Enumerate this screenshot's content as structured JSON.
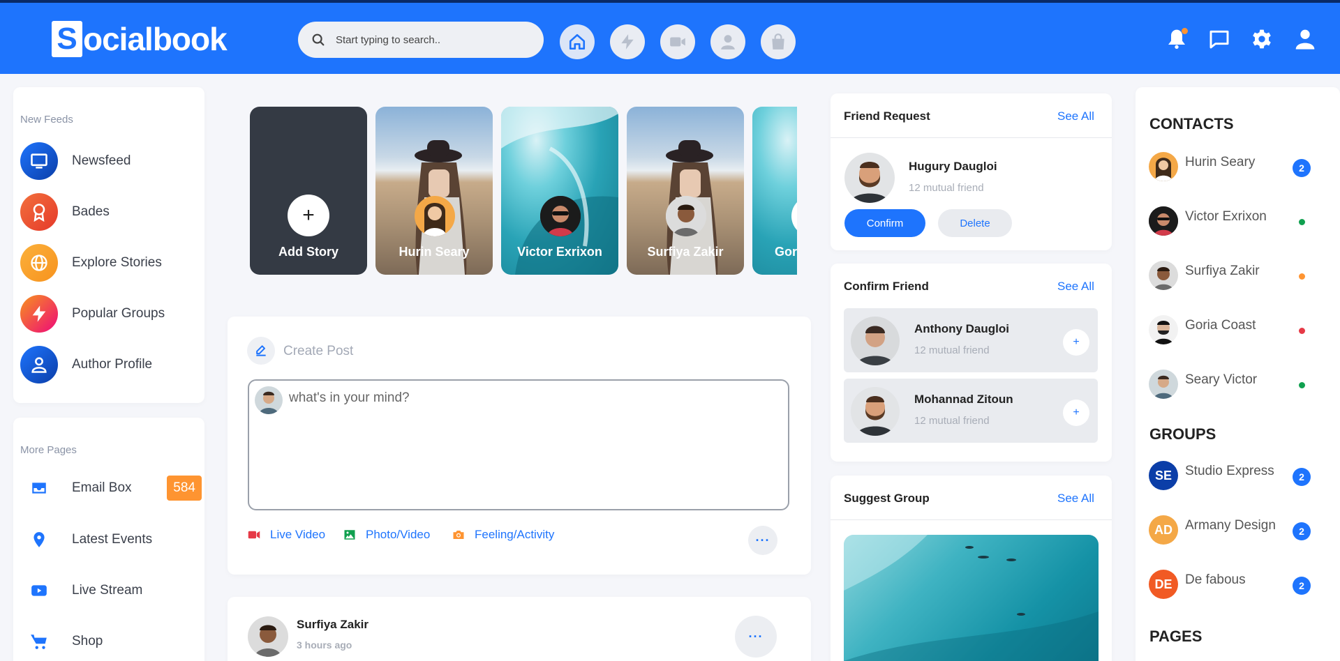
{
  "app": {
    "logo_letter": "S",
    "logo_rest": "ocialbook"
  },
  "search": {
    "placeholder": "Start typing to search.."
  },
  "colors": {
    "primary": "#1e74fd",
    "orange": "#fe9431",
    "dark": "#343a44"
  },
  "header_icons": [
    "home-icon",
    "lightning-icon",
    "video-icon",
    "user-icon",
    "shopping-bag-icon"
  ],
  "header_right_icons": [
    "bell-icon",
    "chat-icon",
    "settings-icon",
    "user-icon"
  ],
  "sidebar": {
    "feeds_title": "New Feeds",
    "feeds": [
      {
        "label": "Newsfeed",
        "icon": "tv-icon"
      },
      {
        "label": "Bades",
        "icon": "badge-icon"
      },
      {
        "label": "Explore Stories",
        "icon": "globe-icon"
      },
      {
        "label": "Popular Groups",
        "icon": "lightning-icon"
      },
      {
        "label": "Author Profile",
        "icon": "user-icon"
      }
    ],
    "pages_title": "More Pages",
    "pages": [
      {
        "label": "Email Box",
        "icon": "inbox-icon",
        "badge": "584"
      },
      {
        "label": "Latest Events",
        "icon": "map-pin-icon"
      },
      {
        "label": "Live Stream",
        "icon": "youtube-icon"
      },
      {
        "label": "Shop",
        "icon": "cart-icon"
      }
    ]
  },
  "stories": {
    "add_label": "Add Story",
    "items": [
      {
        "name": "Hurin Seary"
      },
      {
        "name": "Victor Exrixon"
      },
      {
        "name": "Surfiya Zakir"
      },
      {
        "name": "Gor"
      }
    ]
  },
  "create_post": {
    "title": "Create Post",
    "placeholder": "what's in your mind?",
    "actions": [
      {
        "label": "Live Video",
        "icon": "video-icon"
      },
      {
        "label": "Photo/Video",
        "icon": "image-icon"
      },
      {
        "label": "Feeling/Activity",
        "icon": "camera-icon"
      }
    ],
    "more": "···"
  },
  "post": {
    "author": "Surfiya Zakir",
    "time": "3 hours ago",
    "more": "···"
  },
  "friend_request": {
    "title": "Friend Request",
    "see_all": "See All",
    "name": "Hugury Daugloi",
    "mutual": "12 mutual friend",
    "confirm": "Confirm",
    "delete": "Delete"
  },
  "confirm_friend": {
    "title": "Confirm Friend",
    "see_all": "See All",
    "items": [
      {
        "name": "Anthony Daugloi",
        "mutual": "12 mutual friend",
        "action": "+"
      },
      {
        "name": "Mohannad Zitoun",
        "mutual": "12 mutual friend",
        "action": "+"
      }
    ]
  },
  "suggest_group": {
    "title": "Suggest Group",
    "see_all": "See All"
  },
  "contacts": {
    "title": "CONTACTS",
    "items": [
      {
        "name": "Hurin Seary",
        "badge": "2"
      },
      {
        "name": "Victor Exrixon",
        "status": "#10a04f"
      },
      {
        "name": "Surfiya Zakir",
        "status": "#fe9431"
      },
      {
        "name": "Goria Coast",
        "status": "#e63946"
      },
      {
        "name": "Seary Victor",
        "status": "#10a04f"
      }
    ]
  },
  "groups": {
    "title": "GROUPS",
    "items": [
      {
        "initials": "SE",
        "name": "Studio Express",
        "badge": "2",
        "color": "#0b3ea8"
      },
      {
        "initials": "AD",
        "name": "Armany Design",
        "badge": "2",
        "color": "#f4a847"
      },
      {
        "initials": "DE",
        "name": "De fabous",
        "badge": "2",
        "color": "#f15a24"
      }
    ]
  },
  "pages_section": {
    "title": "PAGES"
  }
}
